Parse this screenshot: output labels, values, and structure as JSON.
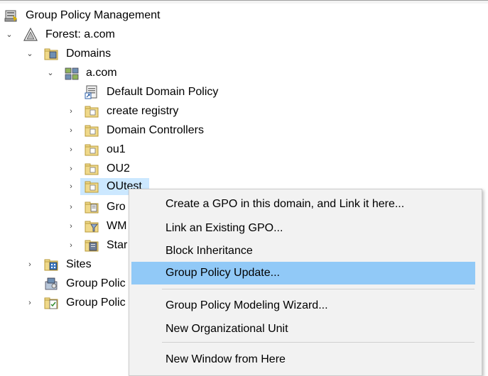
{
  "tree": {
    "root": "Group Policy Management",
    "forest": "Forest: a.com",
    "domains": "Domains",
    "domain": "a.com",
    "items": [
      "Default Domain Policy",
      "create registry",
      "Domain Controllers",
      "ou1",
      "OU2",
      "OUtest",
      "Gro",
      "WM",
      "Star"
    ],
    "sites": "Sites",
    "gp_modeling": "Group Polic",
    "gp_results": "Group Polic"
  },
  "context_menu": {
    "items": [
      "Create a GPO in this domain, and Link it here...",
      "Link an Existing GPO...",
      "Block Inheritance",
      "Group Policy Update...",
      "Group Policy Modeling Wizard...",
      "New Organizational Unit",
      "New Window from Here"
    ],
    "highlighted": "Group Policy Update..."
  }
}
